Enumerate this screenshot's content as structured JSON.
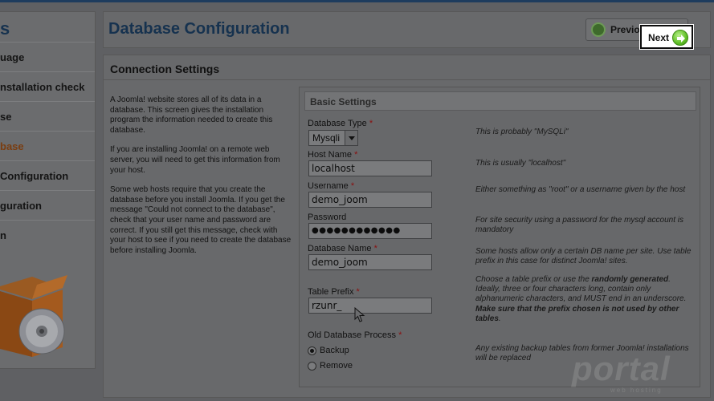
{
  "sidebar": {
    "title": "s",
    "items": [
      {
        "label": "uage",
        "active": false
      },
      {
        "label": "nstallation check",
        "active": false
      },
      {
        "label": "se",
        "active": false
      },
      {
        "label": "base",
        "active": true
      },
      {
        "label": "Configuration",
        "active": false
      },
      {
        "label": "guration",
        "active": false
      },
      {
        "label": "n",
        "active": false
      }
    ]
  },
  "header": {
    "title": "Database Configuration",
    "previous_label": "Previous",
    "next_label": "Next"
  },
  "main": {
    "section_title": "Connection Settings",
    "intro": [
      "A Joomla! website stores all of its data in a database. This screen gives the installation program the information needed to create this database.",
      "If you are installing Joomla! on a remote web server, you will need to get this information from your host.",
      "Some web hosts require that you create the database before you install Joomla. If you get the message \"Could not connect to the database\", check that your user name and password are correct. If you still get this message, check with your host to see if you need to create the database before installing Joomla."
    ],
    "basic_settings": {
      "title": "Basic Settings",
      "db_type": {
        "label": "Database Type",
        "value": "Mysqli",
        "help": "This is probably \"MySQLi\""
      },
      "host": {
        "label": "Host Name",
        "value": "localhost",
        "help": "This is usually \"localhost\""
      },
      "username": {
        "label": "Username",
        "value": "demo_joom",
        "help": "Either something as \"root\" or a username given by the host"
      },
      "password": {
        "label": "Password",
        "value": "●●●●●●●●●●●●",
        "help": "For site security using a password for the mysql account is mandatory"
      },
      "db_name": {
        "label": "Database Name",
        "value": "demo_joom",
        "help": "Some hosts allow only a certain DB name per site. Use table prefix in this case for distinct Joomla! sites."
      },
      "prefix": {
        "label": "Table Prefix",
        "value": "rzunr_",
        "help_1": "Choose a table prefix or use the ",
        "help_bold_1": "randomly generated",
        "help_2": ". Ideally, three or four characters long, contain only alphanumeric characters, and MUST end in an underscore. ",
        "help_bold_2": "Make sure that the prefix chosen is not used by other tables",
        "help_3": "."
      },
      "old_process": {
        "label": "Old Database Process",
        "options": [
          "Backup",
          "Remove"
        ],
        "selected": "Backup",
        "help": "Any existing backup tables from former Joomla! installations will be replaced"
      }
    }
  },
  "watermark": {
    "brand": "portal",
    "sub": "web hosting"
  },
  "colors": {
    "title_blue": "#16324f",
    "required_red": "#8a1010",
    "next_green": "#5fbf26",
    "overlay_gray": "#5f6063"
  }
}
